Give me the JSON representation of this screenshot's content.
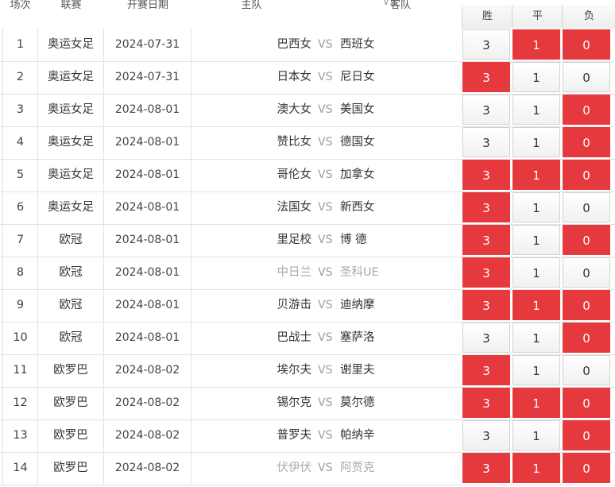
{
  "header": {
    "no": "场次",
    "league": "联赛",
    "date": "开赛日期",
    "home": "主队",
    "vs": "VS",
    "away": "客队",
    "win": "胜",
    "draw": "平",
    "lose": "负"
  },
  "colors": {
    "selected": "#e5393e",
    "vs": "#9aa0a6",
    "muted": "#aaaaaa"
  },
  "rows": [
    {
      "no": "1",
      "league": "奥运女足",
      "date": "2024-07-31",
      "home": "巴西女",
      "away": "西班女",
      "win": "3",
      "draw": "1",
      "lose": "0",
      "sel": [
        false,
        true,
        true
      ],
      "muted": false
    },
    {
      "no": "2",
      "league": "奥运女足",
      "date": "2024-07-31",
      "home": "日本女",
      "away": "尼日女",
      "win": "3",
      "draw": "1",
      "lose": "0",
      "sel": [
        true,
        false,
        false
      ],
      "muted": false
    },
    {
      "no": "3",
      "league": "奥运女足",
      "date": "2024-08-01",
      "home": "澳大女",
      "away": "美国女",
      "win": "3",
      "draw": "1",
      "lose": "0",
      "sel": [
        false,
        false,
        true
      ],
      "muted": false
    },
    {
      "no": "4",
      "league": "奥运女足",
      "date": "2024-08-01",
      "home": "赞比女",
      "away": "德国女",
      "win": "3",
      "draw": "1",
      "lose": "0",
      "sel": [
        false,
        false,
        true
      ],
      "muted": false
    },
    {
      "no": "5",
      "league": "奥运女足",
      "date": "2024-08-01",
      "home": "哥伦女",
      "away": "加拿女",
      "win": "3",
      "draw": "1",
      "lose": "0",
      "sel": [
        true,
        true,
        true
      ],
      "muted": false
    },
    {
      "no": "6",
      "league": "奥运女足",
      "date": "2024-08-01",
      "home": "法国女",
      "away": "新西女",
      "win": "3",
      "draw": "1",
      "lose": "0",
      "sel": [
        true,
        false,
        false
      ],
      "muted": false
    },
    {
      "no": "7",
      "league": "欧冠",
      "date": "2024-08-01",
      "home": "里足校",
      "away": "博 德",
      "win": "3",
      "draw": "1",
      "lose": "0",
      "sel": [
        true,
        false,
        true
      ],
      "muted": false
    },
    {
      "no": "8",
      "league": "欧冠",
      "date": "2024-08-01",
      "home": "中日兰",
      "away": "圣科UE",
      "win": "3",
      "draw": "1",
      "lose": "0",
      "sel": [
        true,
        false,
        false
      ],
      "muted": true
    },
    {
      "no": "9",
      "league": "欧冠",
      "date": "2024-08-01",
      "home": "贝游击",
      "away": "迪纳摩",
      "win": "3",
      "draw": "1",
      "lose": "0",
      "sel": [
        true,
        true,
        true
      ],
      "muted": false
    },
    {
      "no": "10",
      "league": "欧冠",
      "date": "2024-08-01",
      "home": "巴战士",
      "away": "塞萨洛",
      "win": "3",
      "draw": "1",
      "lose": "0",
      "sel": [
        false,
        false,
        true
      ],
      "muted": false
    },
    {
      "no": "11",
      "league": "欧罗巴",
      "date": "2024-08-02",
      "home": "埃尔夫",
      "away": "谢里夫",
      "win": "3",
      "draw": "1",
      "lose": "0",
      "sel": [
        true,
        false,
        false
      ],
      "muted": false
    },
    {
      "no": "12",
      "league": "欧罗巴",
      "date": "2024-08-02",
      "home": "锡尔克",
      "away": "莫尔德",
      "win": "3",
      "draw": "1",
      "lose": "0",
      "sel": [
        true,
        true,
        true
      ],
      "muted": false
    },
    {
      "no": "13",
      "league": "欧罗巴",
      "date": "2024-08-02",
      "home": "普罗夫",
      "away": "帕纳辛",
      "win": "3",
      "draw": "1",
      "lose": "0",
      "sel": [
        false,
        false,
        true
      ],
      "muted": false
    },
    {
      "no": "14",
      "league": "欧罗巴",
      "date": "2024-08-02",
      "home": "伏伊伏",
      "away": "阿贾克",
      "win": "3",
      "draw": "1",
      "lose": "0",
      "sel": [
        true,
        true,
        true
      ],
      "muted": true
    }
  ]
}
